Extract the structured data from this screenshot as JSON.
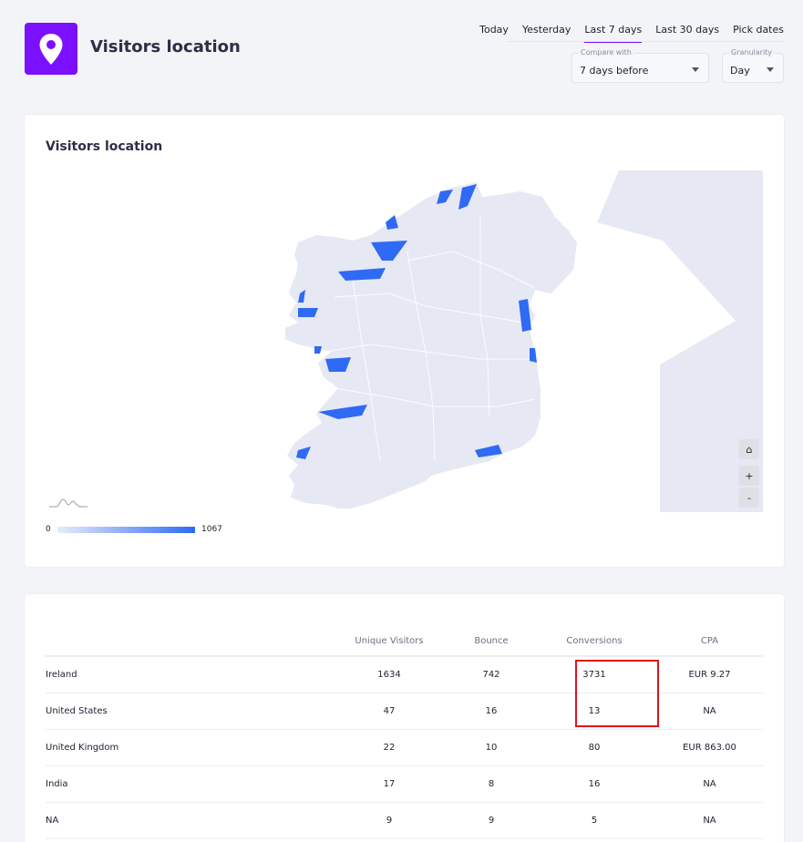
{
  "header": {
    "title": "Visitors location",
    "date_tabs": [
      "Today",
      "Yesterday",
      "Last 7 days",
      "Last 30 days",
      "Pick dates"
    ],
    "active_tab": "Last 7 days",
    "compare": {
      "label": "Compare with",
      "value": "7 days before"
    },
    "granularity": {
      "label": "Granularity",
      "value": "Day"
    }
  },
  "map_card": {
    "title": "Visitors location",
    "legend": {
      "min": "0",
      "max": "1067"
    },
    "controls": {
      "home": "⌂",
      "zoom_in": "+",
      "zoom_out": "-"
    }
  },
  "table": {
    "headers": [
      "",
      "Unique Visitors",
      "Bounce",
      "Conversions",
      "CPA"
    ],
    "rows": [
      [
        "Ireland",
        "1634",
        "742",
        "3731",
        "EUR 9.27"
      ],
      [
        "United States",
        "47",
        "16",
        "13",
        "NA"
      ],
      [
        "United Kingdom",
        "22",
        "10",
        "80",
        "EUR 863.00"
      ],
      [
        "India",
        "17",
        "8",
        "16",
        "NA"
      ],
      [
        "NA",
        "9",
        "9",
        "5",
        "NA"
      ]
    ]
  },
  "colors": {
    "accent": "#7b10ff",
    "map_land": "#e6e8f4",
    "map_highlight": "#2f6af5",
    "annotation": "#e0121b"
  }
}
